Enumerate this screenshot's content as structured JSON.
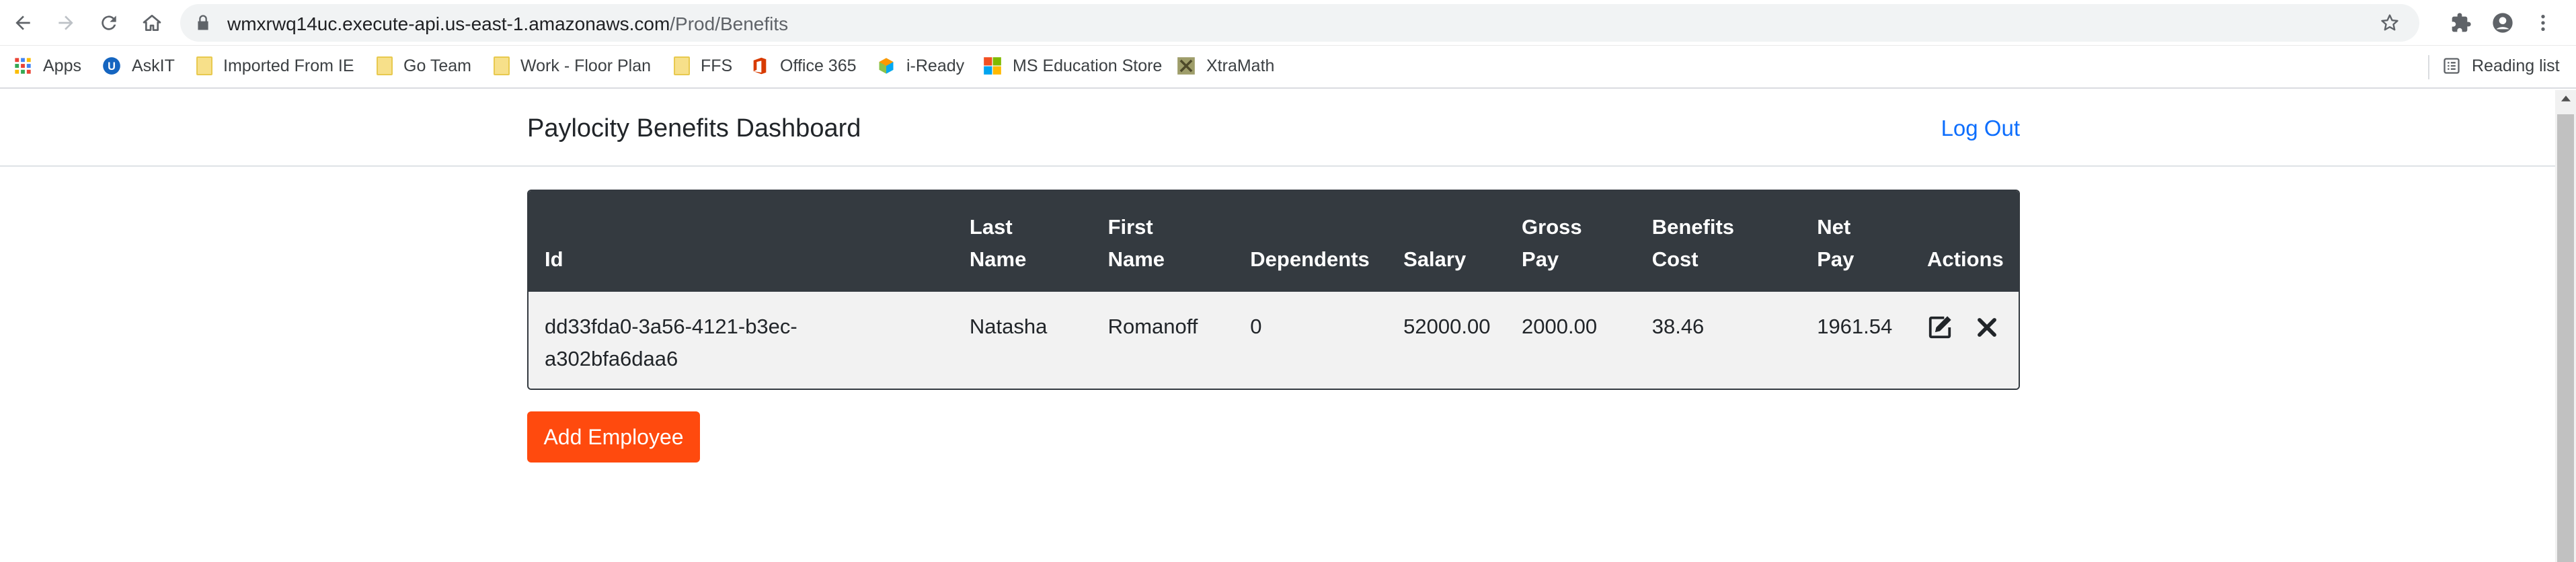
{
  "browser": {
    "url_host": "wmxrwq14uc.execute-api.us-east-1.amazonaws.com",
    "url_path": "/Prod/Benefits",
    "bookmarks": [
      {
        "label": "Apps",
        "icon": "apps-grid-icon"
      },
      {
        "label": "AskIT",
        "icon": "askit-icon"
      },
      {
        "label": "Imported From IE",
        "icon": "folder-icon"
      },
      {
        "label": "Go Team",
        "icon": "folder-icon"
      },
      {
        "label": "Work - Floor Plan",
        "icon": "folder-icon"
      },
      {
        "label": "FFS",
        "icon": "folder-icon"
      },
      {
        "label": "Office 365",
        "icon": "office-icon"
      },
      {
        "label": "i-Ready",
        "icon": "iready-icon"
      },
      {
        "label": "MS Education Store",
        "icon": "microsoft-icon"
      },
      {
        "label": "XtraMath",
        "icon": "xtramath-icon"
      }
    ],
    "reading_list": "Reading list"
  },
  "app": {
    "title": "Paylocity Benefits Dashboard",
    "logout_label": "Log Out"
  },
  "table": {
    "headers": {
      "id": "Id",
      "last_name": [
        "Last",
        "Name"
      ],
      "first_name": [
        "First",
        "Name"
      ],
      "dependents": "Dependents",
      "salary": "Salary",
      "gross_pay": [
        "Gross",
        "Pay"
      ],
      "benefits_cost": [
        "Benefits",
        "Cost"
      ],
      "net_pay": [
        "Net",
        "Pay"
      ],
      "actions": "Actions"
    },
    "rows": [
      {
        "id": [
          "dd33fda0-3a56-4121-b3ec-",
          "a302bfa6daa6"
        ],
        "last_name": "Natasha",
        "first_name": "Romanoff",
        "dependents": "0",
        "salary": "52000.00",
        "gross_pay": "2000.00",
        "benefits_cost": "38.46",
        "net_pay": "1961.54"
      }
    ]
  },
  "add_employee_label": "Add Employee",
  "colors": {
    "header_bg": "#343a40",
    "row_bg": "#f2f2f2",
    "link": "#0d6efd",
    "button": "#ff4a0e"
  }
}
